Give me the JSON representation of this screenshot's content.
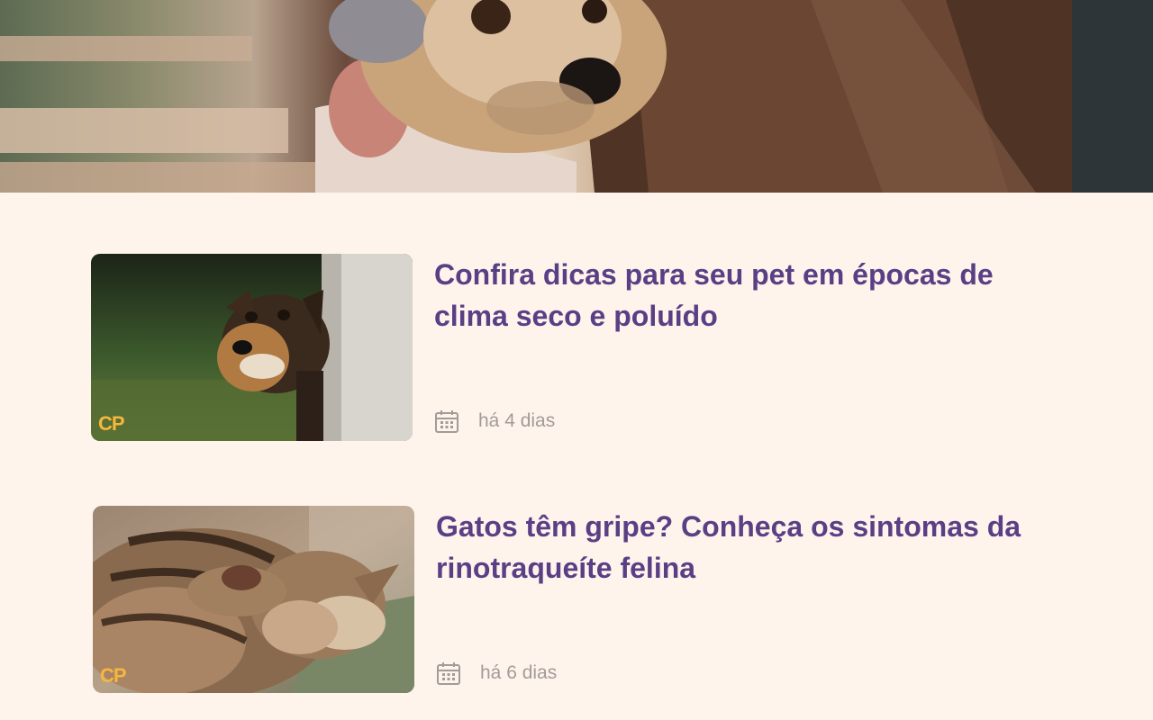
{
  "hero": {
    "image": "dog-hug-banner"
  },
  "articles": [
    {
      "title": "Confira dicas para seu pet em épocas de clima seco e poluído",
      "date": "há 4 dias",
      "thumbnail": "dog-peeking-photo",
      "logo": "CP"
    },
    {
      "title": "Gatos têm gripe? Conheça os sintomas da rinotraqueíte felina",
      "date": "há 6 dias",
      "thumbnail": "cat-covering-face-photo",
      "logo": "CP"
    }
  ],
  "icons": {
    "date": "calendar-icon"
  },
  "colors": {
    "background": "#fef4ec",
    "title": "#5a3f85",
    "meta": "#a39b98",
    "logo": "#f6b73c"
  }
}
